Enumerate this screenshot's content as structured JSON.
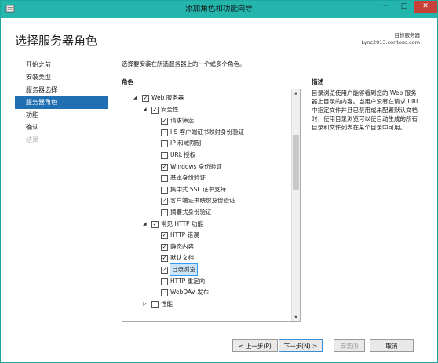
{
  "window": {
    "title": "添加角色和功能向导",
    "min_label": "─",
    "max_label": "□",
    "close_label": "✕"
  },
  "header": {
    "page_title": "选择服务器角色",
    "target_label": "目标服务器",
    "target_server": "Lync2013.contoso.com"
  },
  "nav": {
    "items": [
      {
        "label": "开始之前",
        "state": "normal"
      },
      {
        "label": "安装类型",
        "state": "normal"
      },
      {
        "label": "服务器选择",
        "state": "normal"
      },
      {
        "label": "服务器角色",
        "state": "active"
      },
      {
        "label": "功能",
        "state": "normal"
      },
      {
        "label": "确认",
        "state": "normal"
      },
      {
        "label": "结果",
        "state": "disabled"
      }
    ]
  },
  "main": {
    "intro": "选择要安装在所选服务器上的一个或多个角色。",
    "roles_header": "角色",
    "description_header": "描述",
    "description": "目录浏览使用户能够看到您的 Web 服务器上目录的内容。当用户没有在请求 URL 中指定文件并且已禁用或未配置默认文档时，使用目录浏览可以使自动生成的所有目录和文件列表在某个目录中可用。",
    "tree": [
      {
        "label": "Web 服务器",
        "checked": true,
        "level": 0,
        "expand": "◢"
      },
      {
        "label": "安全性",
        "checked": true,
        "level": 1,
        "expand": "◢"
      },
      {
        "label": "请求筛选",
        "checked": true,
        "level": 2,
        "expand": ""
      },
      {
        "label": "IIS 客户端证书映射身份验证",
        "checked": false,
        "level": 2,
        "expand": ""
      },
      {
        "label": "IP 和域限制",
        "checked": false,
        "level": 2,
        "expand": ""
      },
      {
        "label": "URL 授权",
        "checked": false,
        "level": 2,
        "expand": ""
      },
      {
        "label": "Windows 身份验证",
        "checked": true,
        "level": 2,
        "expand": ""
      },
      {
        "label": "基本身份验证",
        "checked": false,
        "level": 2,
        "expand": ""
      },
      {
        "label": "集中式 SSL 证书支持",
        "checked": false,
        "level": 2,
        "expand": ""
      },
      {
        "label": "客户端证书映射身份验证",
        "checked": true,
        "level": 2,
        "expand": ""
      },
      {
        "label": "摘要式身份验证",
        "checked": false,
        "level": 2,
        "expand": ""
      },
      {
        "label": "常见 HTTP 功能",
        "checked": true,
        "level": 1,
        "expand": "◢"
      },
      {
        "label": "HTTP 错误",
        "checked": true,
        "level": 2,
        "expand": ""
      },
      {
        "label": "静态内容",
        "checked": true,
        "level": 2,
        "expand": ""
      },
      {
        "label": "默认文档",
        "checked": true,
        "level": 2,
        "expand": ""
      },
      {
        "label": "目录浏览",
        "checked": true,
        "level": 2,
        "expand": "",
        "selected": true
      },
      {
        "label": "HTTP 重定向",
        "checked": false,
        "level": 2,
        "expand": ""
      },
      {
        "label": "WebDAV 发布",
        "checked": false,
        "level": 2,
        "expand": ""
      },
      {
        "label": "性能",
        "checked": false,
        "level": 1,
        "expand": "▷"
      }
    ]
  },
  "footer": {
    "prev_label": "< 上一步(P)",
    "next_label": "下一步(N) >",
    "install_label": "安装(I)",
    "cancel_label": "取消"
  }
}
